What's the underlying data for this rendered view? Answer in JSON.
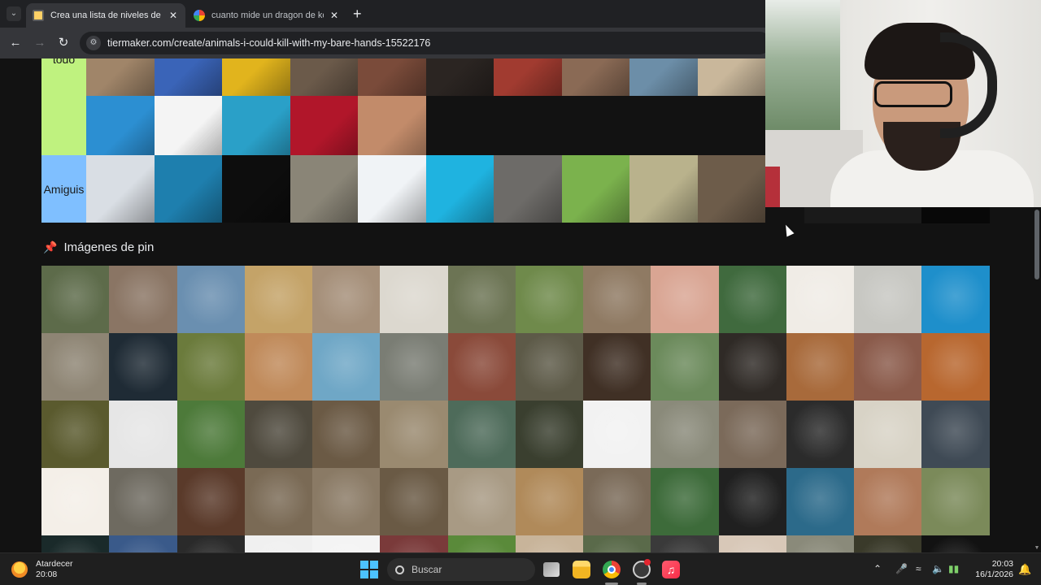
{
  "browser": {
    "tabs": [
      {
        "title": "Crea una lista de niveles de animales",
        "active": true
      },
      {
        "title": "cuanto mide un dragon de komodo",
        "active": false
      }
    ],
    "url": "tiermaker.com/create/animals-i-could-kill-with-my-bare-hands-15522176"
  },
  "tiers": [
    {
      "label": "todo",
      "color": "#bff27f",
      "rows": [
        [
          "#a08569",
          "#3a64b8",
          "#e1b41d",
          "#6b5a4a",
          "#7a4b3a",
          "#2b2522",
          "#a13b30",
          "#8a6a55",
          "#6c8ea8",
          "#c9b79b"
        ],
        [
          "#2c8fd2",
          "#f4f4f4",
          "#2aa0c8",
          "#b1162a",
          "#c28b6a"
        ]
      ]
    },
    {
      "label": "Amiguis",
      "color": "#7fbfff",
      "rows": [
        [
          "#d9dee4",
          "#1e7fae",
          "#0d0d0d",
          "#8a8577",
          "#f0f3f6",
          "#1fb3e0",
          "#6d6b68",
          "#7bb24d",
          "#b9b28c",
          "#6d5c4a"
        ]
      ]
    }
  ],
  "pin_section": {
    "title": "Imágenes de pin",
    "grid": [
      [
        "#5d6b4a",
        "#8a7564",
        "#6a8fb0",
        "#c4a368",
        "#a58f79",
        "#dcd8cf",
        "#6c7454",
        "#6f8a4b",
        "#8f7a63",
        "#d9a593",
        "#406a3e",
        "#f0ece6",
        "#c7c7c2",
        "#1e8fcb"
      ],
      [
        "#8e8574",
        "#1f2b35",
        "#6b7b3c",
        "#c08a5a",
        "#6fa7c6",
        "#7a7d74",
        "#8a4a3a",
        "#5d5a48",
        "#403025",
        "#6b8a5b",
        "#2f2a26",
        "#a86a3b",
        "#8a5a4a",
        "#b8672f"
      ],
      [
        "#5a5a2e",
        "#e6e6e6",
        "#4d7a3a",
        "#4f4a3e",
        "#6b5a45",
        "#9a8a70",
        "#4e6b5a",
        "#3a3f2f",
        "#f2f2f2",
        "#8a8a7a",
        "#7b6a5a",
        "#2b2b2b",
        "#d8d3c6",
        "#3f4a55"
      ],
      [
        "#f4efe8",
        "#6e6a60",
        "#5a3a2a",
        "#7a6a55",
        "#8a7a65",
        "#6a5a45",
        "#a89a84",
        "#b08a5a",
        "#7a6a58",
        "#3d6b3a",
        "#202020",
        "#2c6a8a",
        "#b07a5a",
        "#7b8a5a"
      ],
      [
        "#1a2a2a",
        "#3a5a8a",
        "#2a2a2a",
        "#f0f0f0",
        "#f4f4f4",
        "#7a3a3a",
        "#5a8a3a",
        "#c8b49a",
        "#5a6a4a",
        "#3a3a3a",
        "#d8c8b8",
        "#8a8a7a",
        "#3a3a2a",
        "#121212"
      ]
    ]
  },
  "taskbar": {
    "weather_label": "Atardecer",
    "weather_time": "20:08",
    "search_placeholder": "Buscar",
    "clock_time": "20:03",
    "clock_date": "16/1/2026"
  }
}
